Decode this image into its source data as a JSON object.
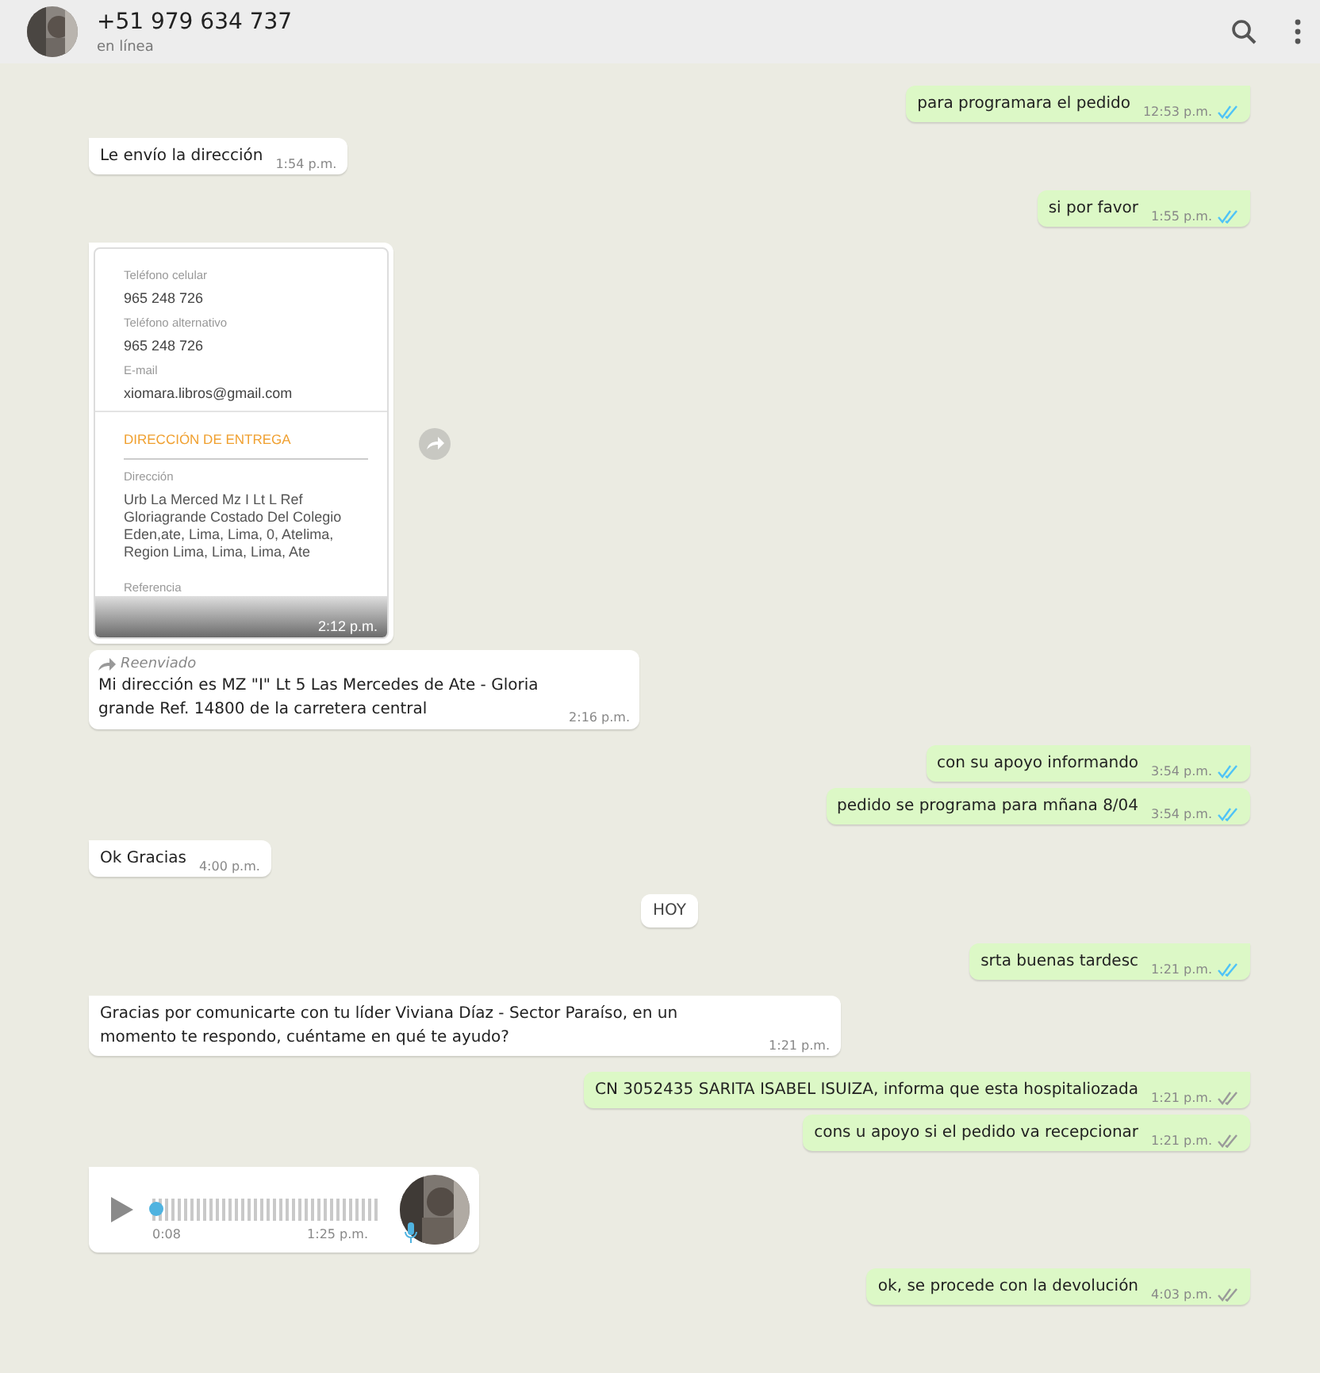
{
  "header": {
    "title": "+51 979 634 737",
    "status": "en línea"
  },
  "messages": [
    {
      "kind": "text",
      "outgoing": true,
      "first": true,
      "text": "para programara el pedido",
      "time": "12:53 p.m.",
      "read": true
    },
    {
      "kind": "text",
      "outgoing": false,
      "first": true,
      "text": "Le envío la dirección",
      "time": "1:54 p.m."
    },
    {
      "kind": "text",
      "outgoing": true,
      "first": true,
      "text": "si por favor",
      "time": "1:55 p.m.",
      "read": true
    },
    {
      "outgoing": false,
      "first": true,
      "time": "2:12 p.m.",
      "document": {
        "fields": [
          {
            "label": "Teléfono celular",
            "value": "965 248 726"
          },
          {
            "label": "Teléfono alternativo",
            "value": "965 248 726"
          },
          {
            "label": "E-mail",
            "value": "xiomara.libros@gmail.com"
          }
        ],
        "section": "DIRECCIÓN DE ENTREGA",
        "address_label": "Dirección",
        "address": "Urb La Merced Mz I Lt L Ref Gloriagrande Costado Del Colegio Eden,ate, Lima, Lima, 0, Atelima, Region Lima, Lima, Lima, Ate",
        "reference_label": "Referencia"
      }
    },
    {
      "kind": "forwarded",
      "outgoing": false,
      "first": false,
      "label": "Reenviado",
      "text": "Mi dirección es MZ \"I\" Lt 5 Las Mercedes de Ate - Gloria grande Ref. 14800 de la carretera central",
      "time": "2:16 p.m."
    },
    {
      "kind": "text",
      "outgoing": true,
      "first": true,
      "text": "con su apoyo informando",
      "time": "3:54 p.m.",
      "read": true
    },
    {
      "kind": "text",
      "outgoing": true,
      "first": false,
      "text": "pedido se programa para mñana  8/04",
      "time": "3:54 p.m.",
      "read": true
    },
    {
      "kind": "text",
      "outgoing": false,
      "first": true,
      "text": "Ok  Gracias",
      "time": "4:00 p.m."
    },
    {
      "kind": "date",
      "text": "HOY"
    },
    {
      "kind": "text",
      "outgoing": true,
      "first": true,
      "text": "srta buenas tardesc",
      "time": "1:21 p.m.",
      "read": true
    },
    {
      "kind": "text",
      "outgoing": false,
      "first": true,
      "text": "Gracias por comunicarte con tu líder Viviana Díaz - Sector Paraíso, en un momento te respondo, cuéntame en qué te ayudo?",
      "time": "1:21 p.m."
    },
    {
      "kind": "text",
      "outgoing": true,
      "first": true,
      "text": "CN 3052435 SARITA ISABEL ISUIZA, informa que esta hospitaliozada",
      "time": "1:21 p.m.",
      "read": false
    },
    {
      "kind": "text",
      "outgoing": true,
      "first": false,
      "text": "cons u apoyo si el pedido va recepcionar",
      "time": "1:21 p.m.",
      "read": false
    },
    {
      "kind": "audio",
      "outgoing": false,
      "first": true,
      "duration": "0:08",
      "time": "1:25 p.m.",
      "level": 0
    },
    {
      "kind": "text",
      "outgoing": true,
      "first": true,
      "text": "ok, se procede con la devolución",
      "time": "4:03 p.m.",
      "read": false
    }
  ]
}
